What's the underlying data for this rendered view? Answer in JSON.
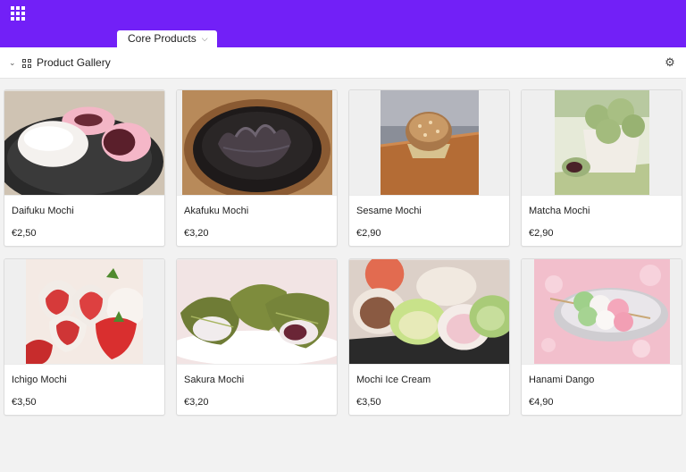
{
  "header": {
    "apps_icon": "grid-apps-icon",
    "table_tab_label": "Core Products"
  },
  "viewbar": {
    "view_name": "Product Gallery",
    "settings_icon": "gear-icon"
  },
  "products": [
    {
      "name": "Daifuku Mochi",
      "price": "€2,50"
    },
    {
      "name": "Akafuku Mochi",
      "price": "€3,20"
    },
    {
      "name": "Sesame Mochi",
      "price": "€2,90"
    },
    {
      "name": "Matcha Mochi",
      "price": "€2,90"
    },
    {
      "name": "Ichigo Mochi",
      "price": "€3,50"
    },
    {
      "name": "Sakura Mochi",
      "price": "€3,20"
    },
    {
      "name": "Mochi Ice Cream",
      "price": "€3,50"
    },
    {
      "name": "Hanami Dango",
      "price": "€4,90"
    }
  ],
  "colors": {
    "brand": "#7220f7",
    "page_background": "#f2f2f2",
    "card_background": "#ffffff"
  }
}
